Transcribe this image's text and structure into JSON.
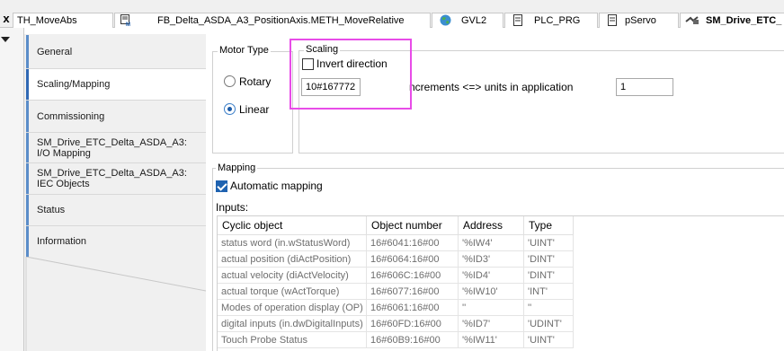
{
  "tabs": [
    {
      "label": "TH_MoveAbs",
      "icon": "none"
    },
    {
      "label": "FB_Delta_ASDA_A3_PositionAxis.METH_MoveRelative",
      "icon": "method-icon"
    },
    {
      "label": "GVL2",
      "icon": "globe-icon"
    },
    {
      "label": "PLC_PRG",
      "icon": "document-icon"
    },
    {
      "label": "pServo",
      "icon": "document-icon"
    },
    {
      "label": "SM_Drive_ETC_",
      "icon": "drive-icon"
    }
  ],
  "close_glyph": "x",
  "sidebar": {
    "items": [
      {
        "label": "General"
      },
      {
        "label": "Scaling/Mapping"
      },
      {
        "label": "Commissioning"
      },
      {
        "label": "SM_Drive_ETC_Delta_ASDA_A3:",
        "label2": "I/O Mapping"
      },
      {
        "label": "SM_Drive_ETC_Delta_ASDA_A3:",
        "label2": "IEC Objects"
      },
      {
        "label": "Status"
      },
      {
        "label": "Information"
      }
    ]
  },
  "motor_type": {
    "title": "Motor Type",
    "rotary_label": "Rotary",
    "linear_label": "Linear",
    "selected": "Linear"
  },
  "scaling": {
    "title": "Scaling",
    "invert_label": "Invert direction",
    "invert_checked": false,
    "increments_value": "10#167772",
    "increments_label": "ncrements <=> units in application",
    "units_value": "1"
  },
  "mapping": {
    "title": "Mapping",
    "auto_label": "Automatic mapping",
    "auto_checked": true,
    "inputs_label": "Inputs:"
  },
  "table": {
    "columns": [
      "Cyclic object",
      "Object number",
      "Address",
      "Type"
    ],
    "rows": [
      [
        "status word (in.wStatusWord)",
        "16#6041:16#00",
        "'%IW4'",
        "'UINT'"
      ],
      [
        "actual position (diActPosition)",
        "16#6064:16#00",
        "'%ID3'",
        "'DINT'"
      ],
      [
        "actual velocity (diActVelocity)",
        "16#606C:16#00",
        "'%ID4'",
        "'DINT'"
      ],
      [
        "actual torque (wActTorque)",
        "16#6077:16#00",
        "'%IW10'",
        "'INT'"
      ],
      [
        "Modes of operation display (OP)",
        "16#6061:16#00",
        "''",
        "''"
      ],
      [
        "digital inputs (in.dwDigitalInputs)",
        "16#60FD:16#00",
        "'%ID7'",
        "'UDINT'"
      ],
      [
        "Touch Probe Status",
        "16#60B9:16#00",
        "'%IW11'",
        "'UINT'"
      ]
    ]
  },
  "colors": {
    "highlight": "#e84ce8",
    "accent": "#1e62b0",
    "sidebar_marker": "#5b8dc9"
  }
}
